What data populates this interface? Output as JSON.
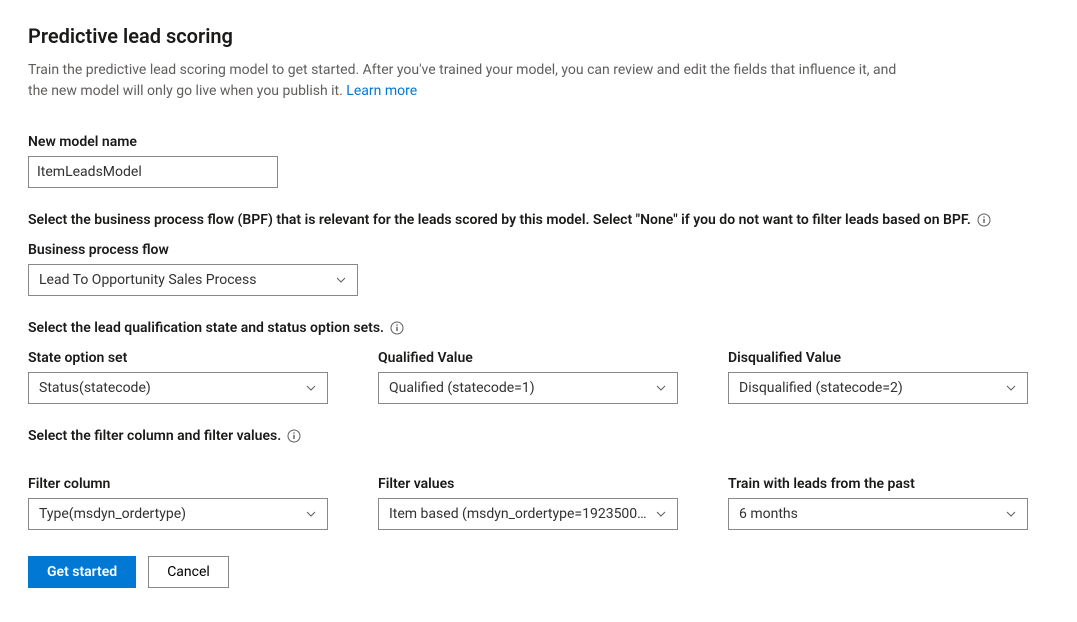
{
  "page": {
    "title": "Predictive lead scoring",
    "intro": "Train the predictive lead scoring model to get started. After you've trained your model, you can review and edit the fields that influence it, and the new model will only go live when you publish it. ",
    "learn_more": "Learn more"
  },
  "model_name": {
    "label": "New model name",
    "value": "ItemLeadsModel"
  },
  "bpf_section": {
    "instruction": "Select the business process flow (BPF) that is relevant for the leads scored by this model. Select \"None\" if you do not want to filter leads based on BPF.",
    "label": "Business process flow",
    "selected": "Lead To Opportunity Sales Process"
  },
  "qualification_section": {
    "instruction": "Select the lead qualification state and status option sets.",
    "state_option_set": {
      "label": "State option set",
      "selected": "Status(statecode)"
    },
    "qualified_value": {
      "label": "Qualified Value",
      "selected": "Qualified (statecode=1)"
    },
    "disqualified_value": {
      "label": "Disqualified Value",
      "selected": "Disqualified (statecode=2)"
    }
  },
  "filter_section": {
    "instruction": "Select the filter column and filter values.",
    "filter_column": {
      "label": "Filter column",
      "selected": "Type(msdyn_ordertype)"
    },
    "filter_values": {
      "label": "Filter values",
      "selected": "Item based (msdyn_ordertype=1923500..."
    },
    "train_with_leads": {
      "label": "Train with leads from the past",
      "selected": "6 months"
    }
  },
  "buttons": {
    "primary": "Get started",
    "secondary": "Cancel"
  }
}
